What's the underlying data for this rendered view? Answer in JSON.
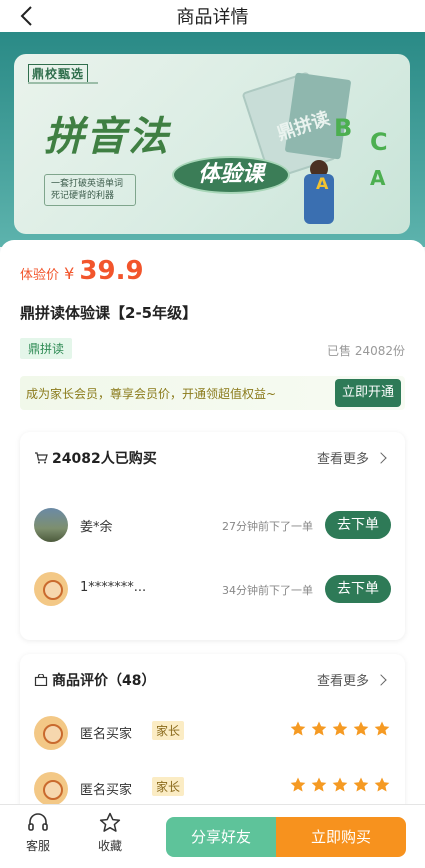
{
  "nav": {
    "title": "商品详情"
  },
  "banner": {
    "brand": "鼎校甄选",
    "headline": "拼音法",
    "pill": "体验课",
    "slogan": "一套打破英语单词死记硬背的利器",
    "book_text": "鼎拼读",
    "letters": [
      "B",
      "C",
      "A",
      "A"
    ]
  },
  "product": {
    "price_label": "体验价",
    "price_symbol": "¥",
    "price_value": "39.9",
    "title": "鼎拼读体验课【2-5年级】",
    "tag": "鼎拼读",
    "sold": "已售 24082份"
  },
  "vip": {
    "text": "成为家长会员，尊享会员价，开通领超值权益~",
    "button": "立即开通"
  },
  "buyers": {
    "header": "24082人已购买",
    "more": "查看更多",
    "items": [
      {
        "name": "姜*余",
        "time": "27分钟前下了一单",
        "button": "去下单"
      },
      {
        "name": "1*******...",
        "time": "34分钟前下了一单",
        "button": "去下单"
      }
    ]
  },
  "reviews": {
    "header": "商品评价（48）",
    "more": "查看更多",
    "items": [
      {
        "name": "匿名买家",
        "role": "家长",
        "rating": 5
      },
      {
        "name": "匿名买家",
        "role": "家长",
        "rating": 5
      }
    ]
  },
  "tabbar": {
    "service": "客服",
    "favorite": "收藏",
    "share": "分享好友",
    "buy": "立即购买"
  },
  "colors": {
    "accent_green": "#2e7a57",
    "price_red": "#f2552c",
    "buy_orange": "#f7921e",
    "share_green": "#5ec39a",
    "star_orange": "#f59a23"
  }
}
